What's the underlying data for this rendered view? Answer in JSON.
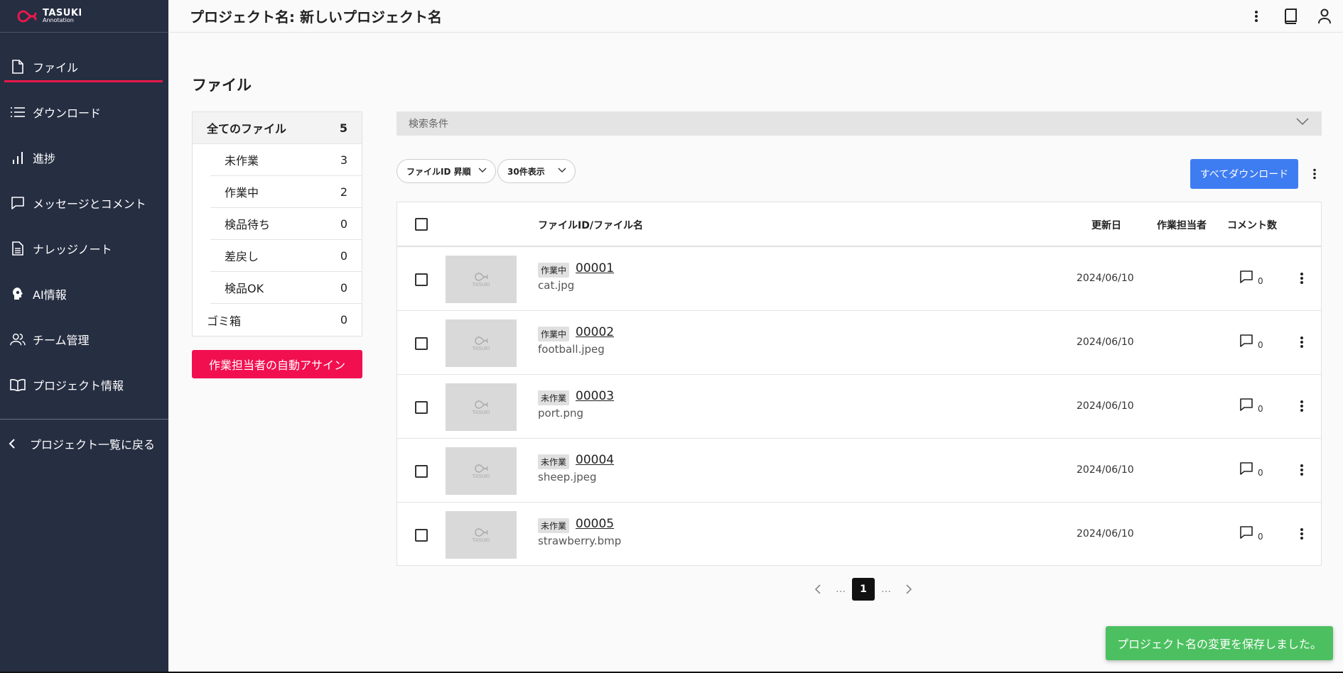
{
  "app": {
    "logo_line1": "TASUKI",
    "logo_line2": "Annotation",
    "accent_color": "#e8194b"
  },
  "sidebar": {
    "items": [
      {
        "label": "ファイル",
        "icon": "file-icon",
        "active": true
      },
      {
        "label": "ダウンロード",
        "icon": "list-icon"
      },
      {
        "label": "進捗",
        "icon": "bar-chart-icon"
      },
      {
        "label": "メッセージとコメント",
        "icon": "chat-icon"
      },
      {
        "label": "ナレッジノート",
        "icon": "document-icon"
      },
      {
        "label": "AI情報",
        "icon": "ai-head-icon"
      },
      {
        "label": "チーム管理",
        "icon": "team-icon"
      },
      {
        "label": "プロジェクト情報",
        "icon": "book-icon"
      }
    ],
    "back_label": "プロジェクト一覧に戻る"
  },
  "header": {
    "title": "プロジェクト名: 新しいプロジェクト名"
  },
  "page": {
    "title": "ファイル"
  },
  "filters": {
    "all": {
      "label": "全てのファイル",
      "count": "5"
    },
    "subs": [
      {
        "label": "未作業",
        "count": "3"
      },
      {
        "label": "作業中",
        "count": "2"
      },
      {
        "label": "検品待ち",
        "count": "0"
      },
      {
        "label": "差戻し",
        "count": "0"
      },
      {
        "label": "検品OK",
        "count": "0"
      }
    ],
    "trash": {
      "label": "ゴミ箱",
      "count": "0"
    }
  },
  "assign_button": "作業担当者の自動アサイン",
  "search": {
    "label": "検索条件"
  },
  "sort": {
    "order": "ファイルID 昇順",
    "per_page": "30件表示"
  },
  "download_all": "すべてダウンロード",
  "table": {
    "headers": {
      "file": "ファイルID/ファイル名",
      "updated": "更新日",
      "assignee": "作業担当者",
      "comments": "コメント数"
    },
    "thumb_text": "TASUKI",
    "rows": [
      {
        "status": "作業中",
        "id": "00001",
        "name": "cat.jpg",
        "date": "2024/06/10",
        "comments": "0"
      },
      {
        "status": "作業中",
        "id": "00002",
        "name": "football.jpeg",
        "date": "2024/06/10",
        "comments": "0"
      },
      {
        "status": "未作業",
        "id": "00003",
        "name": "port.png",
        "date": "2024/06/10",
        "comments": "0"
      },
      {
        "status": "未作業",
        "id": "00004",
        "name": "sheep.jpeg",
        "date": "2024/06/10",
        "comments": "0"
      },
      {
        "status": "未作業",
        "id": "00005",
        "name": "strawberry.bmp",
        "date": "2024/06/10",
        "comments": "0"
      }
    ]
  },
  "pagination": {
    "current": "1",
    "ellipsis": "…"
  },
  "toast": {
    "message": "プロジェクト名の変更を保存しました。"
  }
}
